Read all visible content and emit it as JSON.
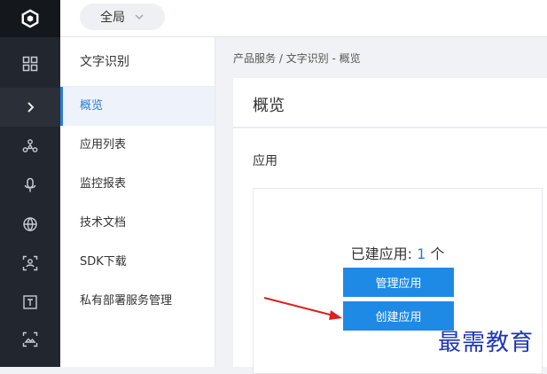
{
  "topbar": {
    "scope_label": "全局"
  },
  "sidebar": {
    "icons": [
      "grid-icon",
      "chevron-right-icon",
      "nodes-icon",
      "microphone-icon",
      "globe-icon",
      "face-scan-icon",
      "text-box-icon",
      "image-scan-icon"
    ]
  },
  "subnav": {
    "title": "文字识别",
    "items": [
      {
        "label": "概览",
        "active": true
      },
      {
        "label": "应用列表"
      },
      {
        "label": "监控报表"
      },
      {
        "label": "技术文档"
      },
      {
        "label": "SDK下载"
      },
      {
        "label": "私有部署服务管理"
      }
    ]
  },
  "main": {
    "breadcrumb": "产品服务 / 文字识别 - 概览",
    "card_title": "概览",
    "section_label": "应用",
    "app_count_prefix": "已建应用: ",
    "app_count": "1",
    "app_count_suffix": " 个",
    "manage_button": "管理应用",
    "create_button": "创建应用"
  },
  "annotation": {
    "arrow_color": "#e02020"
  },
  "watermark": "最需教育",
  "colors": {
    "accent": "#1f8ae6",
    "rail_bg": "#22262e",
    "active_text": "#2d7bd6"
  }
}
